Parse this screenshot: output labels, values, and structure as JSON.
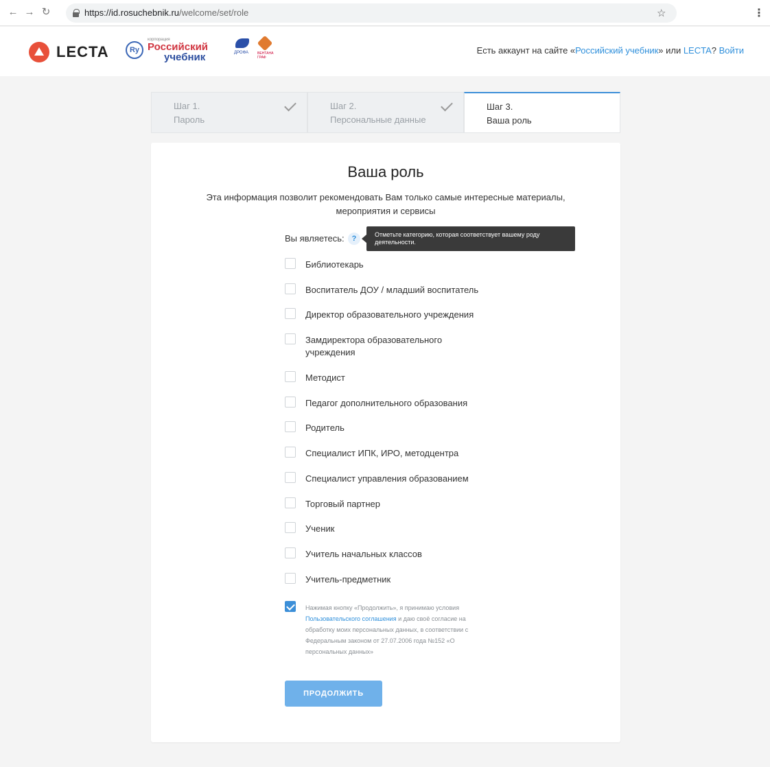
{
  "browser": {
    "url_host": "https://id.rosuchebnik.ru",
    "url_path": "/welcome/set/role",
    "back_icon": "arrow-left-icon",
    "forward_icon": "arrow-right-icon",
    "reload_icon": "reload-icon"
  },
  "header": {
    "lecta_name": "LECTA",
    "ru_logo_small": "корпорация",
    "ru_logo_line1": "Российский",
    "ru_logo_line2": "учебник",
    "drofa_text": "ДРОФА",
    "ventana_text": "ВЕНТАНА ГРАФ",
    "login_prefix": "Есть аккаунт на сайте «",
    "login_site": "Российский учебник",
    "login_middle": "» или ",
    "login_lecta": "LECTA",
    "login_q": "? ",
    "login_link": "Войти"
  },
  "steps": [
    {
      "num": "Шаг 1.",
      "title": "Пароль",
      "done": true
    },
    {
      "num": "Шаг 2.",
      "title": "Персональные данные",
      "done": true
    },
    {
      "num": "Шаг 3.",
      "title": "Ваша роль",
      "done": false
    }
  ],
  "card": {
    "title": "Ваша роль",
    "description": "Эта информация позволит рекомендовать Вам только самые интересные материалы, мероприятия и сервисы",
    "you_are": "Вы являетесь:",
    "help": "?",
    "tooltip": "Отметьте категорию, которая соответствует вашему роду деятельности.",
    "roles": [
      "Библиотекарь",
      "Воспитатель ДОУ / младший воспитатель",
      "Директор образовательного учреждения",
      "Замдиректора образовательного учреждения",
      "Методист",
      "Педагог дополнительного образования",
      "Родитель",
      "Специалист ИПК, ИРО, методцентра",
      "Специалист управления образованием",
      "Торговый партнер",
      "Ученик",
      "Учитель начальных классов",
      "Учитель-предметник"
    ],
    "consent_before": "Нажимая кнопку «Продолжить», я принимаю условия ",
    "consent_link": "Пользовательского соглашения",
    "consent_after": " и даю своё согласие на обработку моих персональных данных, в соответствии с Федеральным законом от 27.07.2006 года №152 «О персональных данных»",
    "consent_checked": true,
    "continue_label": "ПРОДОЛЖИТЬ"
  },
  "colors": {
    "accent": "#3c8fd8",
    "link": "#2e8fdb",
    "button": "#6fb1ea",
    "lecta_red": "#e8503a"
  }
}
